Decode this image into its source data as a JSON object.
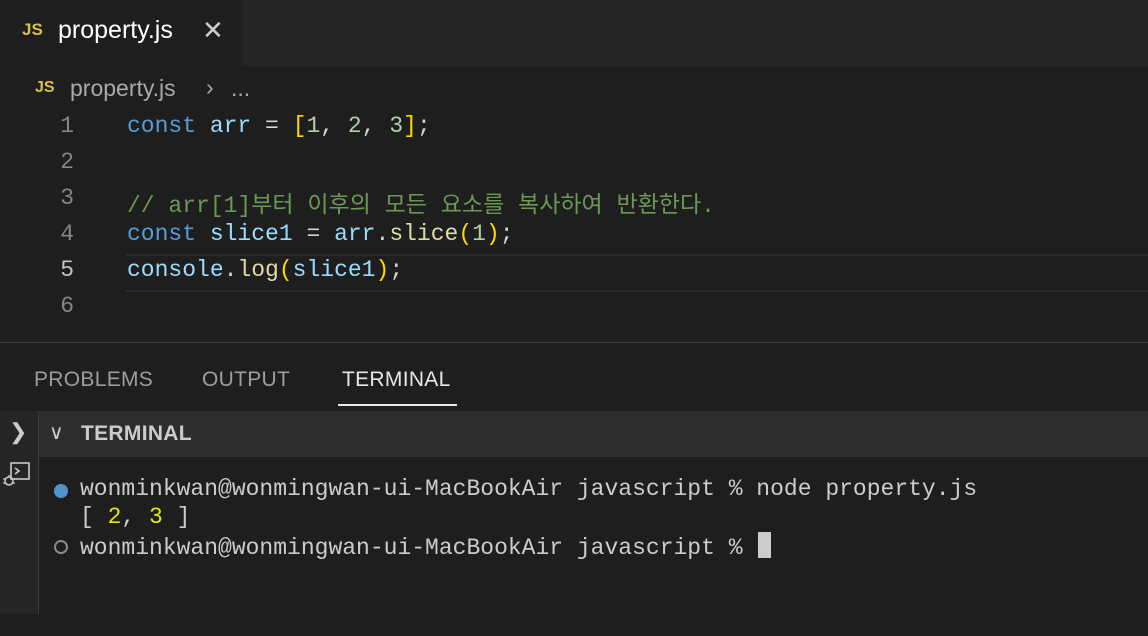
{
  "tab": {
    "badge": "JS",
    "title": "property.js",
    "close": "✕"
  },
  "breadcrumb": {
    "badge": "JS",
    "file": "property.js",
    "sep": "›",
    "more": "..."
  },
  "editor": {
    "lines": [
      {
        "n": "1"
      },
      {
        "n": "2"
      },
      {
        "n": "3",
        "comment": "// arr[1]부터 이후의 모든 요소를 복사하여 반환한다."
      },
      {
        "n": "4"
      },
      {
        "n": "5"
      },
      {
        "n": "6"
      }
    ],
    "tokens": {
      "const": "const",
      "arr": "arr",
      "eq": " = ",
      "lbr": "[",
      "rbr": "]",
      "one": "1",
      "two": "2",
      "three": "3",
      "comma": ", ",
      "semi": ";",
      "slice1": "slice1",
      "dot": ".",
      "slice": "slice",
      "lp": "(",
      "rp": ")",
      "console": "console",
      "log": "log",
      "space": " "
    }
  },
  "panel": {
    "tabs": [
      "PROBLEMS",
      "OUTPUT",
      "TERMINAL"
    ],
    "terminal_title": "TERMINAL",
    "terminal": {
      "line1": "wonminkwan@wonmingwan-ui-MacBookAir javascript % node property.js",
      "out_open": "[ ",
      "out_v1": "2",
      "out_sep": ", ",
      "out_v2": "3",
      "out_close": " ]",
      "line3": "wonminkwan@wonmingwan-ui-MacBookAir javascript % "
    }
  },
  "colors": {
    "accent": "#4e94ce",
    "js_badge": "#d6c24b"
  }
}
